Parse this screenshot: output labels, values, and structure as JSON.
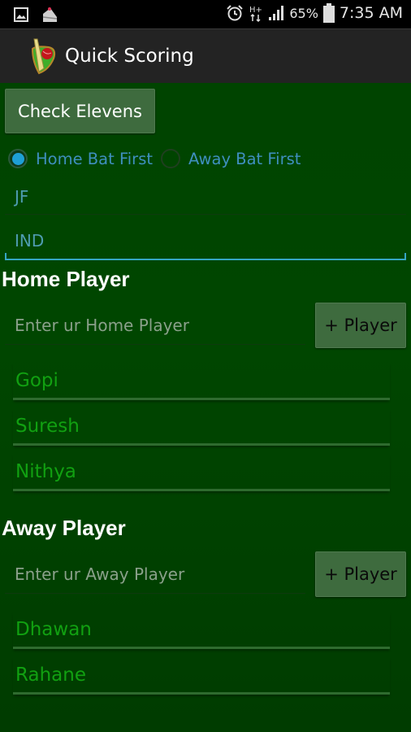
{
  "status_bar": {
    "left_icons": [
      "gallery-icon",
      "cake-icon"
    ],
    "right_icons": [
      "alarm-icon",
      "hplus-data-icon",
      "signal-icon"
    ],
    "battery_percent": "65%",
    "time": "7:35 AM"
  },
  "app_bar": {
    "icon": "cricket-bat-ball-icon",
    "title": "Quick Scoring"
  },
  "main": {
    "check_elevens_label": "Check Elevens",
    "batting_options": [
      {
        "label": "Home Bat First",
        "selected": true
      },
      {
        "label": "Away Bat First",
        "selected": false
      }
    ],
    "home_team_value": "JF",
    "away_team_value": "IND",
    "home_section": {
      "title": "Home Player",
      "input_placeholder": "Enter ur Home Player",
      "add_button_label": "+ Player",
      "players": [
        "Gopi",
        "Suresh",
        "Nithya"
      ]
    },
    "away_section": {
      "title": "Away Player",
      "input_placeholder": "Enter ur Away Player",
      "add_button_label": "+ Player",
      "players": [
        "Dhawan",
        "Rahane"
      ]
    }
  },
  "colors": {
    "background": "#004400",
    "radio_accent": "#1e9fd6",
    "field_focus": "#35a6c2",
    "player_text": "#11a011"
  }
}
